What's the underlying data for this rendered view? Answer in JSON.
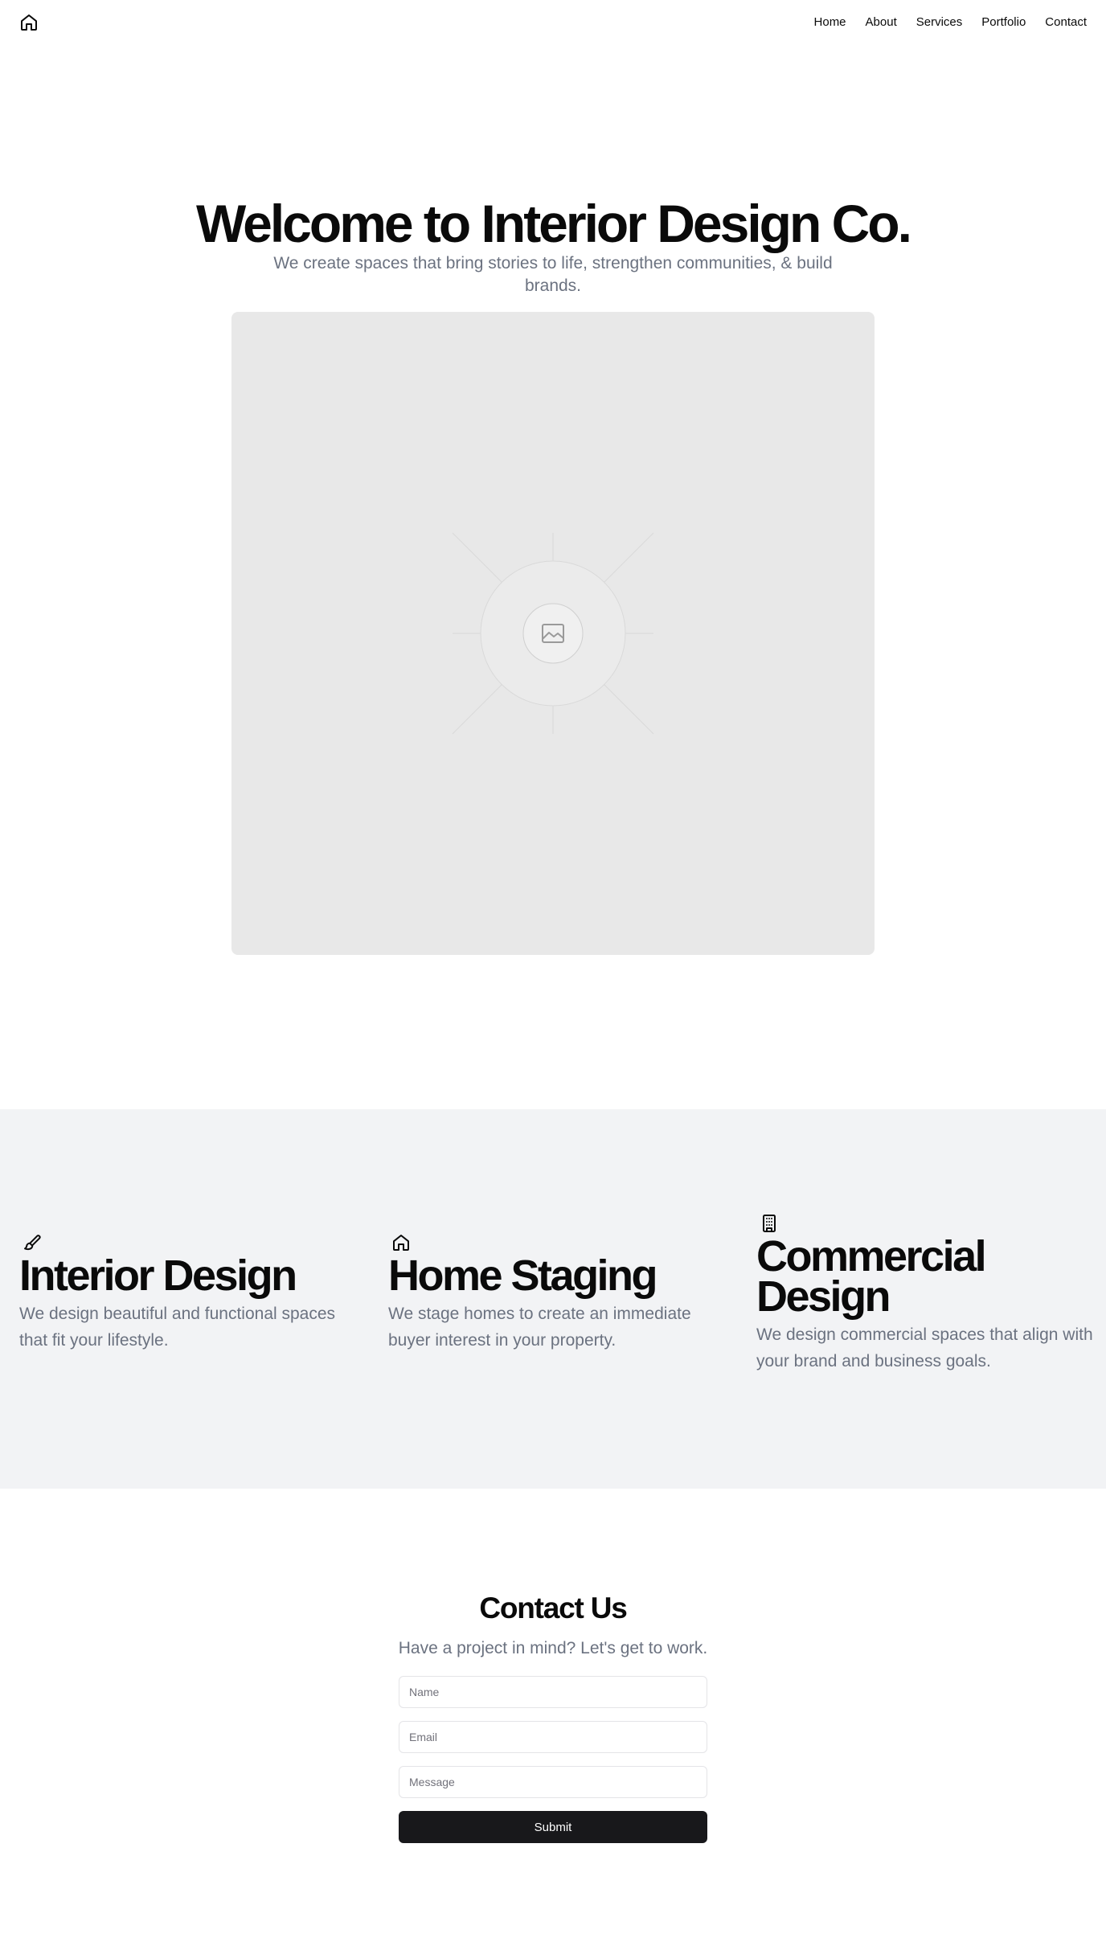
{
  "header": {
    "logo_icon": "home-icon",
    "nav": [
      {
        "label": "Home"
      },
      {
        "label": "About"
      },
      {
        "label": "Services"
      },
      {
        "label": "Portfolio"
      },
      {
        "label": "Contact"
      }
    ]
  },
  "hero": {
    "title": "Welcome to Interior Design Co.",
    "subtitle": "We create spaces that bring stories to life, strengthen communities, & build brands.",
    "image_icon": "image-placeholder-icon"
  },
  "services": [
    {
      "icon": "paintbrush-icon",
      "title": "Interior Design",
      "description": "We design beautiful and functional spaces that fit your lifestyle."
    },
    {
      "icon": "home-icon",
      "title": "Home Staging",
      "description": "We stage homes to create an immediate buyer interest in your property."
    },
    {
      "icon": "building-icon",
      "title": "Commercial Design",
      "description": "We design commercial spaces that align with your brand and business goals."
    }
  ],
  "contact": {
    "title": "Contact Us",
    "subtitle": "Have a project in mind? Let's get to work.",
    "name_placeholder": "Name",
    "email_placeholder": "Email",
    "message_placeholder": "Message",
    "submit_label": "Submit"
  },
  "colors": {
    "text": "#0a0a0a",
    "muted": "#6b7280",
    "services_bg": "#f2f3f5",
    "button_bg": "#18181b"
  }
}
